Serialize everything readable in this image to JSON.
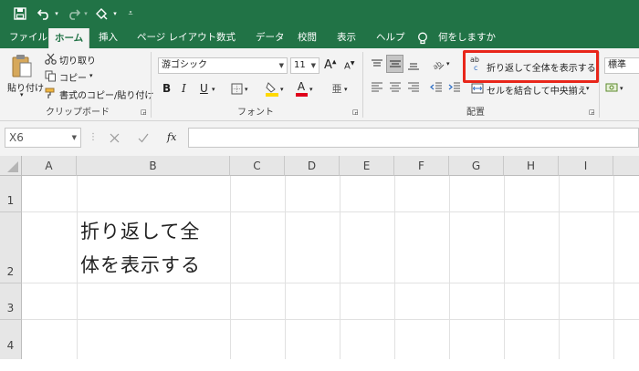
{
  "tabs": [
    "ファイル",
    "ホーム",
    "挿入",
    "ページ レイアウト",
    "数式",
    "データ",
    "校閲",
    "表示",
    "ヘルプ"
  ],
  "tell_me": "何をしますか",
  "clipboard": {
    "paste": "貼り付け",
    "cut": "切り取り",
    "copy": "コピー",
    "format_painter": "書式のコピー/貼り付け",
    "group_label": "クリップボード"
  },
  "font": {
    "name": "游ゴシック",
    "size": "11",
    "grow": "A",
    "shrink": "A",
    "bold": "B",
    "italic": "I",
    "underline": "U",
    "fill_letter": "A",
    "group_label": "フォント",
    "fill_color": "#ffd900",
    "font_color": "#e0001b"
  },
  "alignment": {
    "wrap_text": "折り返して全体を表示する",
    "merge_center": "セルを結合して中央揃え",
    "group_label": "配置",
    "wrap_icon_top": "ab",
    "wrap_icon_bottom": "c"
  },
  "number": {
    "format": "標準"
  },
  "formula_bar": {
    "name_box": "X6",
    "fx": "fx",
    "value": ""
  },
  "sheet": {
    "columns": [
      "A",
      "B",
      "C",
      "D",
      "E",
      "F",
      "G",
      "H",
      "I"
    ],
    "rows": [
      "1",
      "2",
      "3",
      "4"
    ],
    "b2_line1": "折り返して全",
    "b2_line2": "体を表示する"
  },
  "colors": {
    "brand": "#217346",
    "highlight": "#e8261a"
  }
}
